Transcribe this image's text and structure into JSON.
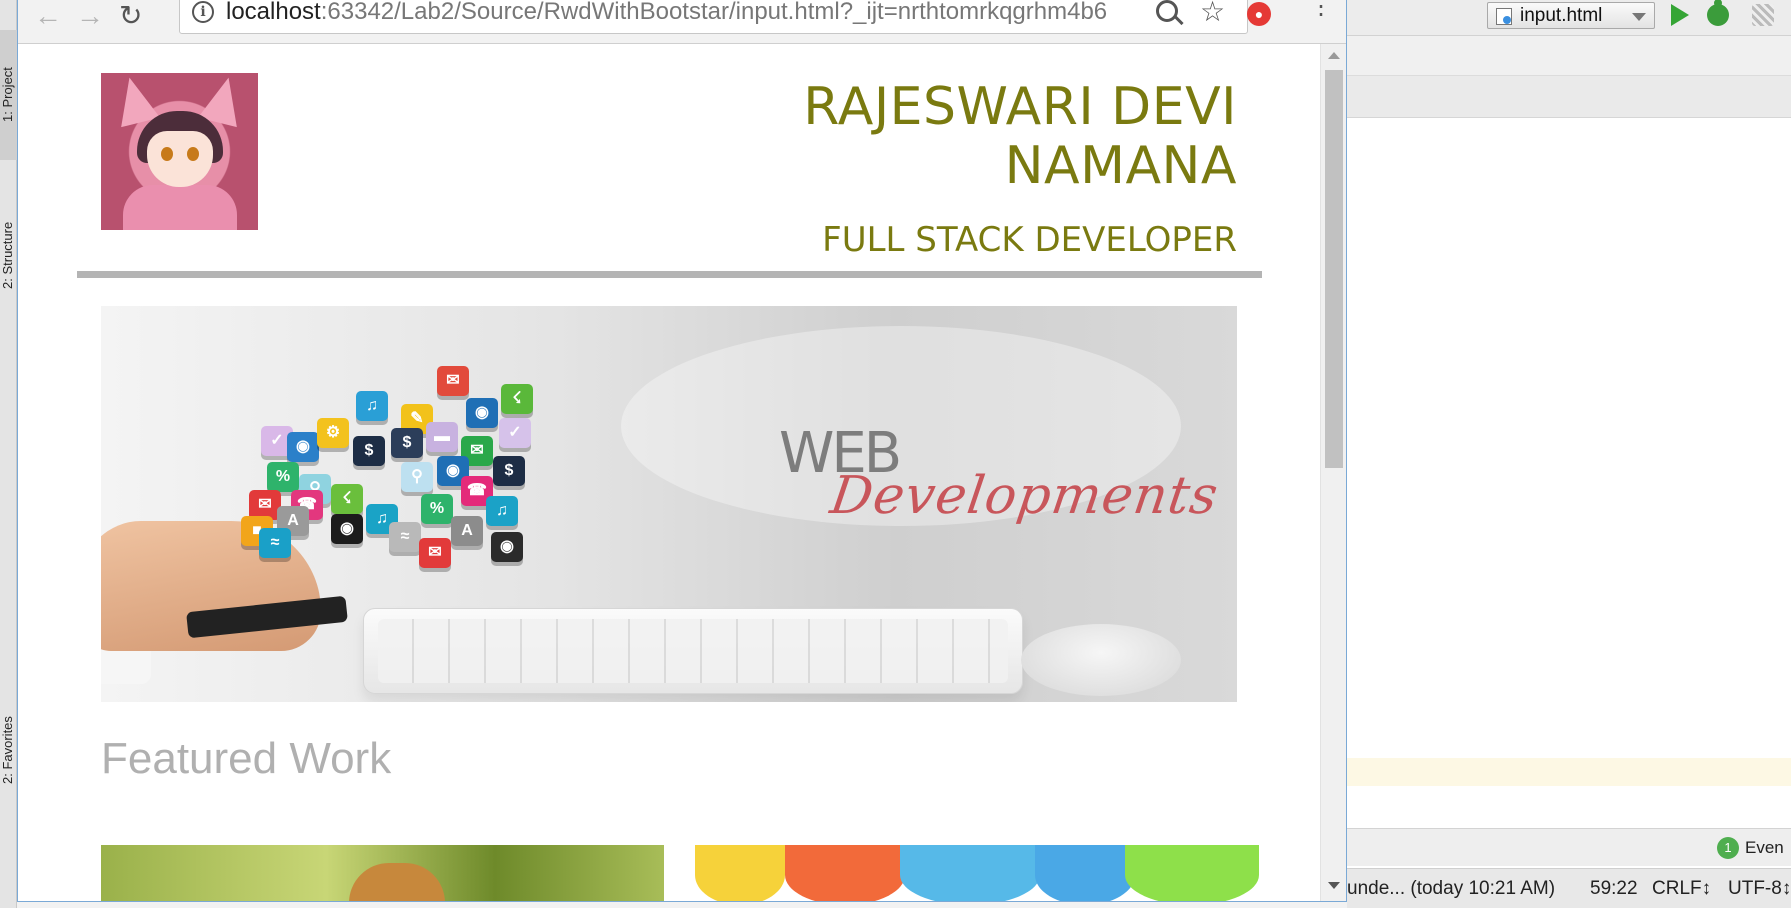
{
  "ide": {
    "left_tabs": [
      "1: Project",
      "2: Structure",
      "2: Favorites"
    ],
    "run_config": "input.html",
    "event_count": "1",
    "event_label": "Even",
    "status": {
      "vcs": "unde... (today 10:21 AM)",
      "position": "59:22",
      "line_sep": "CRLF↕",
      "encoding": "UTF-8↕"
    }
  },
  "browser": {
    "url_host": "localhost",
    "url_rest": ":63342/Lab2/Source/RwdWithBootstar/input.html?_ijt=nrthtomrkqgrhm4b6",
    "back_icon": "←",
    "forward_icon": "→",
    "reload_icon": "↻",
    "star_icon": "☆"
  },
  "page": {
    "name_line1": "RAJESWARI DEVI",
    "name_line2": "NAMANA",
    "role": "FULL STACK DEVELOPER",
    "banner": {
      "word1": "WEB",
      "word2": "Developments"
    },
    "featured_heading": "Featured Work"
  },
  "icons": [
    "back-arrow-icon",
    "forward-arrow-icon",
    "reload-icon",
    "info-icon",
    "zoom-icon",
    "star-icon",
    "adblock-icon",
    "menu-dots-icon",
    "run-icon",
    "debug-icon",
    "coverage-icon",
    "html-file-icon"
  ],
  "colors": {
    "accent_olive": "#7a7a10",
    "divider_gray": "#b4b4b4",
    "featured_gray": "#b0b0b0",
    "dev_script_red": "#c8565b"
  }
}
